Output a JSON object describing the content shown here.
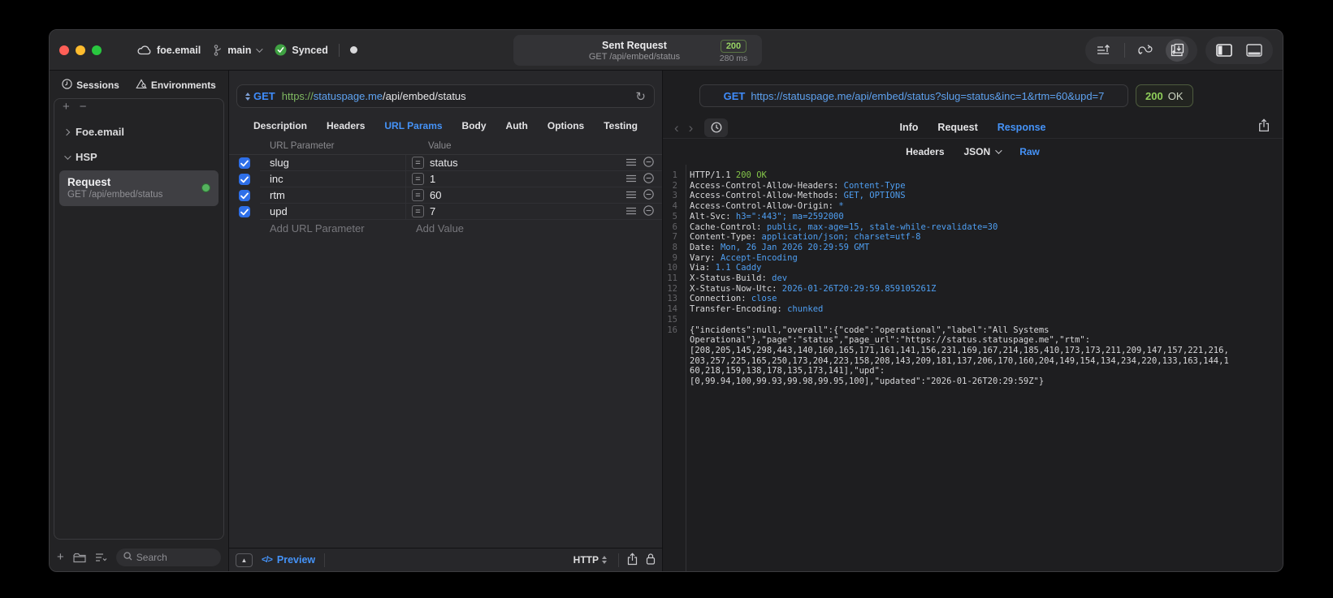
{
  "titlebar": {
    "project": "foe.email",
    "branch": "main",
    "sync_status": "Synced",
    "request_title": "Sent Request",
    "status_code": "200",
    "request_subtitle": "GET /api/embed/status",
    "duration": "280 ms"
  },
  "sidebar": {
    "tabs": [
      {
        "label": "Sessions"
      },
      {
        "label": "Environments"
      }
    ],
    "tree": [
      {
        "label": "Foe.email",
        "state": "collapsed"
      },
      {
        "label": "HSP",
        "state": "expanded"
      }
    ],
    "selected_request": {
      "title": "Request",
      "subtitle": "GET /api/embed/status"
    },
    "search_placeholder": "Search"
  },
  "request_panel": {
    "method": "GET",
    "url_scheme": "https://",
    "url_host": "statuspage.me",
    "url_path": "/api/embed/status",
    "tabs": [
      "Description",
      "Headers",
      "URL Params",
      "Body",
      "Auth",
      "Options",
      "Testing"
    ],
    "active_tab": "URL Params",
    "params_table": {
      "columns": [
        "URL Parameter",
        "Value"
      ],
      "rows": [
        {
          "name": "slug",
          "value": "status",
          "enabled": true
        },
        {
          "name": "inc",
          "value": "1",
          "enabled": true
        },
        {
          "name": "rtm",
          "value": "60",
          "enabled": true
        },
        {
          "name": "upd",
          "value": "7",
          "enabled": true
        }
      ],
      "add_name_placeholder": "Add URL Parameter",
      "add_value_placeholder": "Add Value"
    },
    "footer": {
      "preview_label": "Preview",
      "protocol_label": "HTTP"
    }
  },
  "response_panel": {
    "method": "GET",
    "url": "https://statuspage.me/api/embed/status?slug=status&inc=1&rtm=60&upd=7",
    "status": {
      "code": "200",
      "text": "OK"
    },
    "tabs": [
      "Info",
      "Request",
      "Response"
    ],
    "active_tab": "Response",
    "subtabs": [
      {
        "label": "Headers"
      },
      {
        "label": "JSON",
        "has_dropdown": true
      },
      {
        "label": "Raw"
      }
    ],
    "active_subtab": "Raw",
    "body_lines": [
      {
        "num": "1",
        "segments": [
          {
            "t": "HTTP/1.1 ",
            "c": "p"
          },
          {
            "t": "200 OK",
            "c": "g"
          }
        ]
      },
      {
        "num": "2",
        "segments": [
          {
            "t": "Access-Control-Allow-Headers: ",
            "c": "p"
          },
          {
            "t": "Content-Type",
            "c": "b"
          }
        ]
      },
      {
        "num": "3",
        "segments": [
          {
            "t": "Access-Control-Allow-Methods: ",
            "c": "p"
          },
          {
            "t": "GET, OPTIONS",
            "c": "b"
          }
        ]
      },
      {
        "num": "4",
        "segments": [
          {
            "t": "Access-Control-Allow-Origin: ",
            "c": "p"
          },
          {
            "t": "*",
            "c": "b"
          }
        ]
      },
      {
        "num": "5",
        "segments": [
          {
            "t": "Alt-Svc: ",
            "c": "p"
          },
          {
            "t": "h3=\":443\"; ma=2592000",
            "c": "b"
          }
        ]
      },
      {
        "num": "6",
        "segments": [
          {
            "t": "Cache-Control: ",
            "c": "p"
          },
          {
            "t": "public, max-age=15, stale-while-revalidate=30",
            "c": "b"
          }
        ]
      },
      {
        "num": "7",
        "segments": [
          {
            "t": "Content-Type: ",
            "c": "p"
          },
          {
            "t": "application/json; charset=utf-8",
            "c": "b"
          }
        ]
      },
      {
        "num": "8",
        "segments": [
          {
            "t": "Date: ",
            "c": "p"
          },
          {
            "t": "Mon, 26 Jan 2026 20:29:59 GMT",
            "c": "b"
          }
        ]
      },
      {
        "num": "9",
        "segments": [
          {
            "t": "Vary: ",
            "c": "p"
          },
          {
            "t": "Accept-Encoding",
            "c": "b"
          }
        ]
      },
      {
        "num": "10",
        "segments": [
          {
            "t": "Via: ",
            "c": "p"
          },
          {
            "t": "1.1 Caddy",
            "c": "b"
          }
        ]
      },
      {
        "num": "11",
        "segments": [
          {
            "t": "X-Status-Build: ",
            "c": "p"
          },
          {
            "t": "dev",
            "c": "b"
          }
        ]
      },
      {
        "num": "12",
        "segments": [
          {
            "t": "X-Status-Now-Utc: ",
            "c": "p"
          },
          {
            "t": "2026-01-26T20:29:59.859105261Z",
            "c": "b"
          }
        ]
      },
      {
        "num": "13",
        "segments": [
          {
            "t": "Connection: ",
            "c": "p"
          },
          {
            "t": "close",
            "c": "b"
          }
        ]
      },
      {
        "num": "14",
        "segments": [
          {
            "t": "Transfer-Encoding: ",
            "c": "p"
          },
          {
            "t": "chunked",
            "c": "b"
          }
        ]
      },
      {
        "num": "15",
        "segments": []
      },
      {
        "num": "16",
        "segments": [
          {
            "t": "{\"incidents\":null,\"overall\":{\"code\":\"operational\",\"label\":\"All Systems",
            "c": "p"
          }
        ]
      },
      {
        "num": "",
        "segments": [
          {
            "t": "Operational\"},\"page\":\"status\",\"page_url\":\"https://status.statuspage.me\",\"rtm\":",
            "c": "p"
          }
        ]
      },
      {
        "num": "",
        "segments": [
          {
            "t": "[208,205,145,298,443,140,160,165,171,161,141,156,231,169,167,214,185,410,173,173,211,209,147,157,221,216,",
            "c": "p"
          }
        ]
      },
      {
        "num": "",
        "segments": [
          {
            "t": "203,257,225,165,250,173,204,223,158,208,143,209,181,137,206,170,160,204,149,154,134,234,220,133,163,144,1",
            "c": "p"
          }
        ]
      },
      {
        "num": "",
        "segments": [
          {
            "t": "60,218,159,138,178,135,173,141],\"upd\":",
            "c": "p"
          }
        ]
      },
      {
        "num": "",
        "segments": [
          {
            "t": "[0,99.94,100,99.93,99.98,99.95,100],\"updated\":\"2026-01-26T20:29:59Z\"}",
            "c": "p"
          }
        ]
      }
    ]
  },
  "icons": {
    "equals": "=",
    "plus": "+",
    "minus": "−",
    "refresh": "↻",
    "back": "‹",
    "forward": "›",
    "collapse": "▲"
  },
  "colors": {
    "accent_blue": "#4593f8",
    "status_green": "#8fce5a",
    "method_blue": "#3f8cfb",
    "checkbox_blue": "#2e6fe8"
  }
}
